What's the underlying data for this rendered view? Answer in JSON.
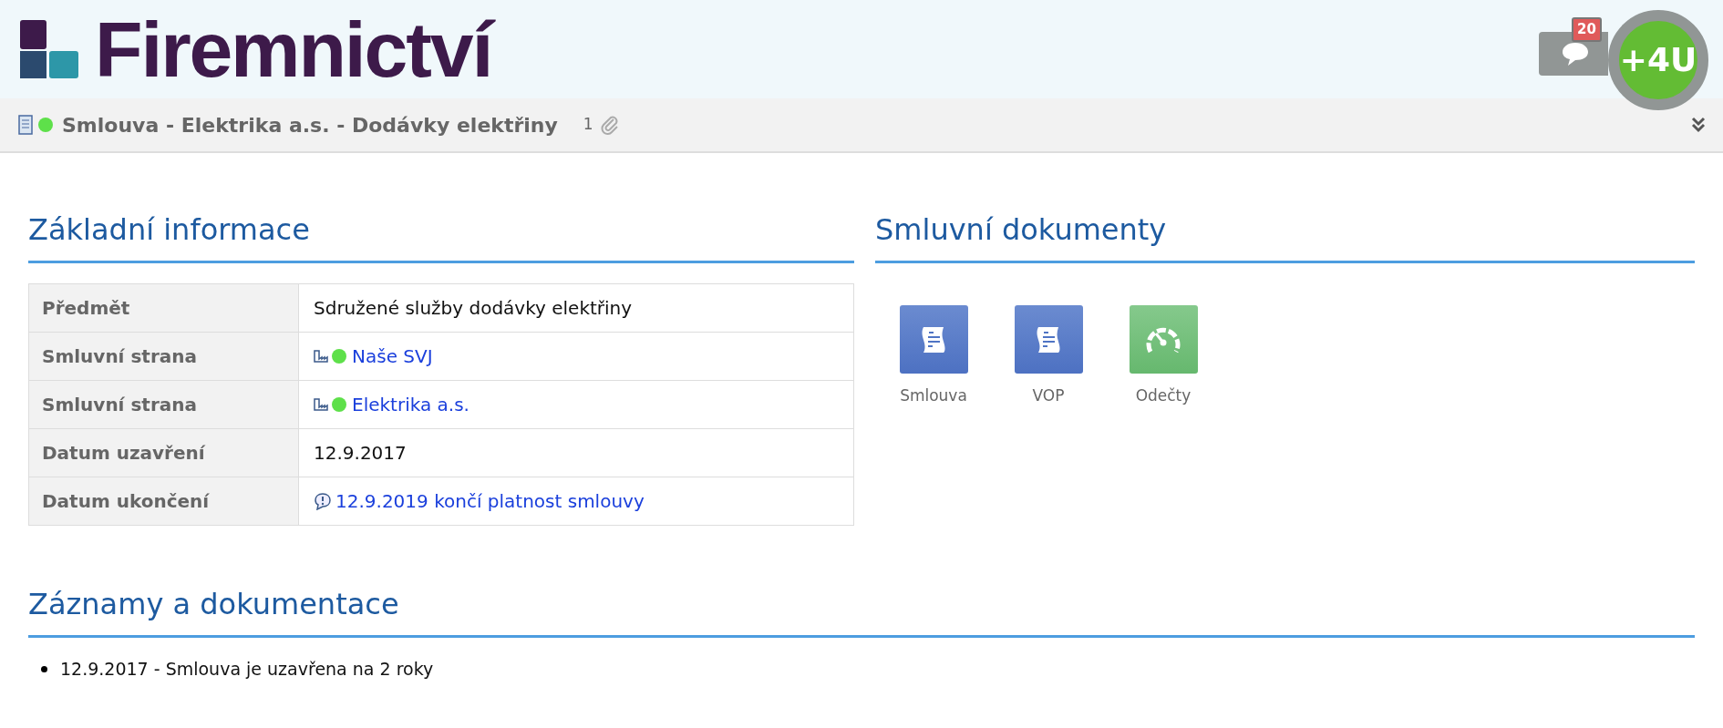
{
  "header": {
    "logo_text": "Firemnictví",
    "messages_badge": "20",
    "user_badge": "+4U"
  },
  "title_bar": {
    "active": true,
    "title": "Smlouva - Elektrika a.s. - Dodávky elektřiny",
    "attachments": "1"
  },
  "basic_info": {
    "heading": "Základní informace",
    "rows": [
      {
        "label": "Předmět",
        "kind": "text",
        "value": "Sdružené služby dodávky elektřiny"
      },
      {
        "label": "Smluvní strana",
        "kind": "party",
        "value": "Naše SVJ",
        "color": "#5ee04a"
      },
      {
        "label": "Smluvní strana",
        "kind": "party",
        "value": "Elektrika a.s.",
        "color": "#5ee04a"
      },
      {
        "label": "Datum uzavření",
        "kind": "text",
        "value": "12.9.2017"
      },
      {
        "label": "Datum ukončení",
        "kind": "warning",
        "value": "12.9.2019 končí platnost smlouvy"
      }
    ]
  },
  "documents": {
    "heading": "Smluvní dokumenty",
    "items": [
      {
        "label": "Smlouva",
        "kind": "document"
      },
      {
        "label": "VOP",
        "kind": "document"
      },
      {
        "label": "Odečty",
        "kind": "meter"
      }
    ]
  },
  "records": {
    "heading": "Záznamy a dokumentace",
    "items": [
      "12.9.2017 - Smlouva je uzavřena na 2 roky"
    ]
  }
}
